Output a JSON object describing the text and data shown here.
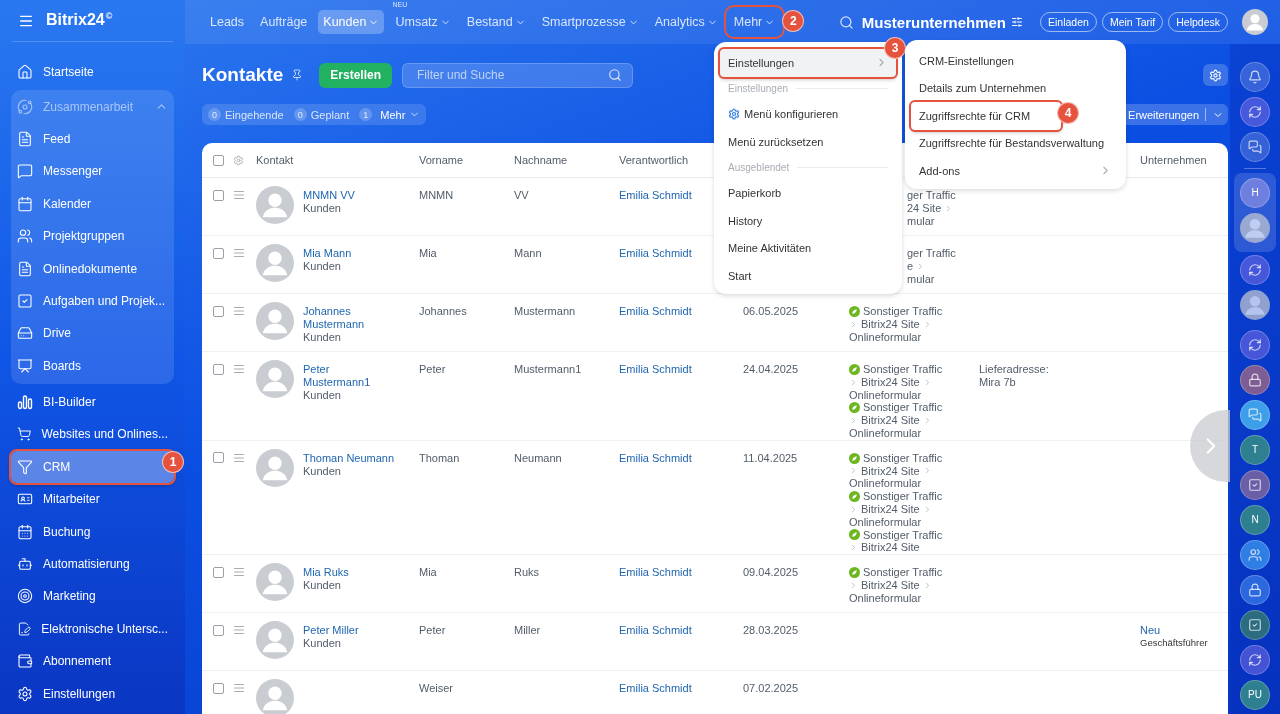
{
  "logo": {
    "text": "Bitrix24",
    "mark": "©"
  },
  "sidebar": {
    "items": [
      {
        "label": "Startseite",
        "selected": false
      },
      {
        "label": "Zusammenarbeit",
        "kind": "group",
        "expanded": true,
        "children": [
          {
            "label": "Feed",
            "selected": false
          },
          {
            "label": "Messenger",
            "selected": false
          },
          {
            "label": "Kalender",
            "selected": false
          },
          {
            "label": "Projektgruppen",
            "selected": false
          },
          {
            "label": "Onlinedokumente",
            "selected": false
          },
          {
            "label": "Aufgaben und Projek...",
            "selected": false
          },
          {
            "label": "Drive",
            "selected": false
          },
          {
            "label": "Boards",
            "selected": false
          }
        ]
      },
      {
        "label": "BI-Builder",
        "selected": false
      },
      {
        "label": "Websites und Onlines...",
        "selected": false
      },
      {
        "label": "CRM",
        "selected": true,
        "callout": "1"
      },
      {
        "label": "Mitarbeiter",
        "selected": false
      },
      {
        "label": "Buchung",
        "selected": false
      },
      {
        "label": "Automatisierung",
        "selected": false
      },
      {
        "label": "Marketing",
        "selected": false
      },
      {
        "label": "Elektronische Untersc...",
        "selected": false
      },
      {
        "label": "Abonnement",
        "selected": false
      },
      {
        "label": "Einstellungen",
        "selected": false
      }
    ]
  },
  "nav": {
    "tabs": [
      {
        "label": "Leads",
        "selected": false,
        "dropdown": false
      },
      {
        "label": "Aufträge",
        "selected": false,
        "dropdown": false
      },
      {
        "label": "Kunden",
        "selected": true,
        "dropdown": true
      },
      {
        "label": "Umsatz",
        "selected": false,
        "dropdown": true,
        "badge": "NEU"
      },
      {
        "label": "Bestand",
        "selected": false,
        "dropdown": true
      },
      {
        "label": "Smartprozesse",
        "selected": false,
        "dropdown": true
      },
      {
        "label": "Analytics",
        "selected": false,
        "dropdown": true
      },
      {
        "label": "Mehr",
        "selected": false,
        "dropdown": true,
        "callout": "2"
      }
    ],
    "company": "Musterunternehmen",
    "buttons": [
      "Einladen",
      "Mein Tarif",
      "Helpdesk"
    ]
  },
  "page": {
    "title": "Kontakte",
    "create_button": "Erstellen",
    "search": {
      "placeholder": "Filter und Suche"
    },
    "counters": [
      {
        "count": "0",
        "label": "Eingehende",
        "dropdown": false
      },
      {
        "count": "0",
        "label": "Geplant",
        "dropdown": false
      },
      {
        "count": "1",
        "label": "Mehr",
        "dropdown": true
      }
    ],
    "extensions_button": "Erweiterungen"
  },
  "table": {
    "header_checked": false,
    "columns": [
      "Kontakt",
      "Vorname",
      "Nachname",
      "Verantwortlich",
      "Unternehmen"
    ],
    "rows": [
      {
        "checked": false,
        "name": "MNMN VV",
        "type": "Kunden",
        "first": "MNMN",
        "last": "VV",
        "owner": "Emilia Schmidt",
        "clipped": true,
        "sources": [
          {
            "channel": "ger Traffic",
            "site": "24 Site",
            "form": "mular"
          }
        ]
      },
      {
        "checked": false,
        "name": "Mia Mann",
        "type": "Kunden",
        "first": "Mia",
        "last": "Mann",
        "owner": "Emilia Schmidt",
        "clipped": true,
        "sources": [
          {
            "channel": "ger Traffic",
            "site": "e",
            "form": "mular"
          }
        ]
      },
      {
        "checked": false,
        "name": "Johannes Mustermann",
        "type": "Kunden",
        "first": "Johannes",
        "last": "Mustermann",
        "owner": "Emilia Schmidt",
        "date": "06.05.2025",
        "clipped": false,
        "sources": [
          {
            "channel": "Sonstiger Traffic",
            "site": "Bitrix24 Site",
            "form": "Onlineformular"
          }
        ]
      },
      {
        "checked": false,
        "name": "Peter Mustermann1",
        "type": "Kunden",
        "first": "Peter",
        "last": "Mustermann1",
        "owner": "Emilia Schmidt",
        "date": "24.04.2025",
        "clipped": false,
        "sources": [
          {
            "channel": "Sonstiger Traffic",
            "site": "Bitrix24 Site",
            "form": "Onlineformular"
          },
          {
            "channel": "Sonstiger Traffic",
            "site": "Bitrix24 Site",
            "form": "Onlineformular"
          }
        ],
        "address": [
          "Lieferadresse:",
          "Mira 7b"
        ]
      },
      {
        "checked": false,
        "name": "Thoman Neumann",
        "type": "Kunden",
        "first": "Thoman",
        "last": "Neumann",
        "owner": "Emilia Schmidt",
        "date": "11.04.2025",
        "clipped": false,
        "sources": [
          {
            "channel": "Sonstiger Traffic",
            "site": "Bitrix24 Site",
            "form": "Onlineformular"
          },
          {
            "channel": "Sonstiger Traffic",
            "site": "Bitrix24 Site",
            "form": "Onlineformular"
          },
          {
            "channel": "Sonstiger Traffic",
            "site": "Bitrix24 Site"
          }
        ]
      },
      {
        "checked": false,
        "name": "Mia Ruks",
        "type": "Kunden",
        "first": "Mia",
        "last": "Ruks",
        "owner": "Emilia Schmidt",
        "date": "09.04.2025",
        "clipped": false,
        "sources": [
          {
            "channel": "Sonstiger Traffic",
            "site": "Bitrix24 Site",
            "form": "Onlineformular"
          }
        ]
      },
      {
        "checked": false,
        "name": "Peter Miller",
        "type": "Kunden",
        "first": "Peter",
        "last": "Miller",
        "owner": "Emilia Schmidt",
        "date": "28.03.2025",
        "sources": [],
        "company": {
          "name": "Neu",
          "role": "Geschäftsführer"
        }
      },
      {
        "checked": false,
        "first": "Weiser",
        "owner": "Emilia Schmidt",
        "date": "07.02.2025",
        "sources": []
      }
    ]
  },
  "menu": {
    "items": [
      {
        "kind": "submenu",
        "label": "Einstellungen",
        "open": true,
        "callout": "3"
      },
      {
        "kind": "section",
        "label": "Einstellungen"
      },
      {
        "kind": "gear",
        "label": "Menü konfigurieren"
      },
      {
        "kind": "item",
        "label": "Menü zurücksetzen"
      },
      {
        "kind": "section",
        "label": "Ausgeblendet"
      },
      {
        "kind": "item",
        "label": "Papierkorb"
      },
      {
        "kind": "item",
        "label": "History"
      },
      {
        "kind": "item",
        "label": "Meine Aktivitäten"
      },
      {
        "kind": "item",
        "label": "Start"
      }
    ]
  },
  "submenu": {
    "items": [
      {
        "kind": "item",
        "label": "CRM-Einstellungen"
      },
      {
        "kind": "item",
        "label": "Details zum Unternehmen"
      },
      {
        "kind": "item",
        "label": "Zugriffsrechte für CRM",
        "callout": "4"
      },
      {
        "kind": "item",
        "label": "Zugriffsrechte für Bestandsverwaltung"
      },
      {
        "kind": "submenu",
        "label": "Add-ons",
        "open": false
      }
    ]
  },
  "rail": {
    "items": [
      {
        "kind": "bell"
      },
      {
        "kind": "copilot"
      },
      {
        "kind": "chat"
      },
      {
        "kind": "divider"
      },
      {
        "kind": "letter",
        "label": "H",
        "color": "#6f7fe0",
        "group": true
      },
      {
        "kind": "avatar",
        "group": true
      },
      {
        "kind": "copilot"
      },
      {
        "kind": "avatar"
      },
      {
        "kind": "copilot"
      },
      {
        "kind": "lock",
        "color": "#7d5d93"
      },
      {
        "kind": "chat",
        "color": "#3d9fe9"
      },
      {
        "kind": "letter",
        "label": "T",
        "color": "#2e7f8f"
      },
      {
        "kind": "check",
        "color": "#6a5fa6"
      },
      {
        "kind": "letter",
        "label": "N",
        "color": "#2e7f8f"
      },
      {
        "kind": "people",
        "color": "#2f7ee6"
      },
      {
        "kind": "lock",
        "color": "#2b68de"
      },
      {
        "kind": "check",
        "color": "#2c6c80"
      },
      {
        "kind": "copilot"
      },
      {
        "kind": "letter",
        "label": "PU",
        "color": "#2e7f8f"
      }
    ]
  }
}
